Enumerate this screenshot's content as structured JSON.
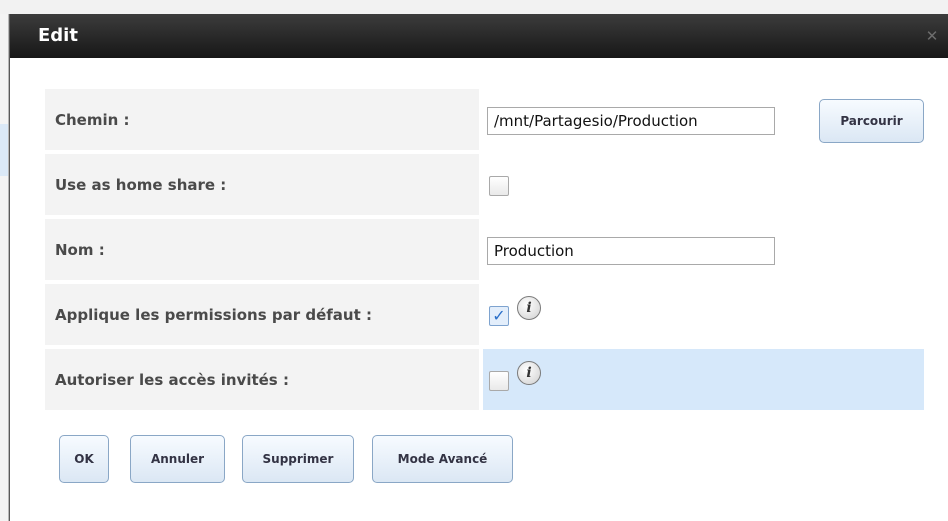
{
  "dialog": {
    "title": "Edit",
    "close_icon": "close-icon"
  },
  "form": {
    "path": {
      "label": "Chemin :",
      "value": "/mnt/Partagesio/Production",
      "browse_label": "Parcourir"
    },
    "home_share": {
      "label": "Use as home share :",
      "checked": false
    },
    "name": {
      "label": "Nom :",
      "value": "Production"
    },
    "default_permissions": {
      "label": "Applique les permissions par défaut :",
      "checked": true,
      "info_icon": "info-icon"
    },
    "guest_access": {
      "label": "Autoriser les accès invités :",
      "checked": false,
      "info_icon": "info-icon"
    }
  },
  "buttons": {
    "ok": "OK",
    "cancel": "Annuler",
    "delete": "Supprimer",
    "advanced": "Mode Avancé"
  },
  "info_glyph": "i",
  "colors": {
    "titlebar": "#1f1f1f",
    "highlight_row": "#d6e8fa",
    "button_border": "#8aa7c6"
  }
}
